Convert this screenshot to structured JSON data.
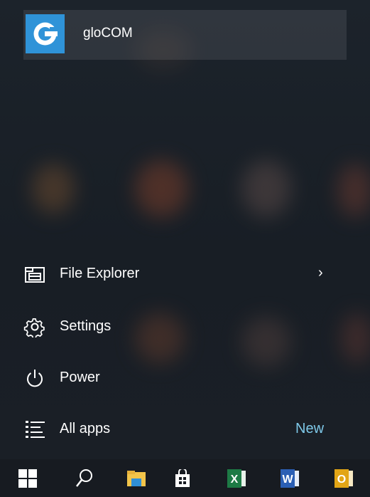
{
  "recent_app": {
    "name": "gloCOM",
    "icon": "glocom-logo-icon"
  },
  "menu": {
    "file_explorer": {
      "label": "File Explorer",
      "chevron": "›"
    },
    "settings": {
      "label": "Settings"
    },
    "power": {
      "label": "Power"
    },
    "all_apps": {
      "label": "All apps",
      "badge": "New"
    }
  },
  "taskbar": {
    "icons": [
      "windows-start-icon",
      "search-icon",
      "file-explorer-icon",
      "store-icon",
      "excel-icon",
      "word-icon",
      "outlook-icon"
    ],
    "excel_letter": "X",
    "word_letter": "W",
    "outlook_letter": "O"
  },
  "colors": {
    "accent": "#2f93d8",
    "new_badge": "#7ec8e8",
    "excel": "#1d7a45",
    "word": "#2b5fb4",
    "outlook": "#e2a516"
  }
}
